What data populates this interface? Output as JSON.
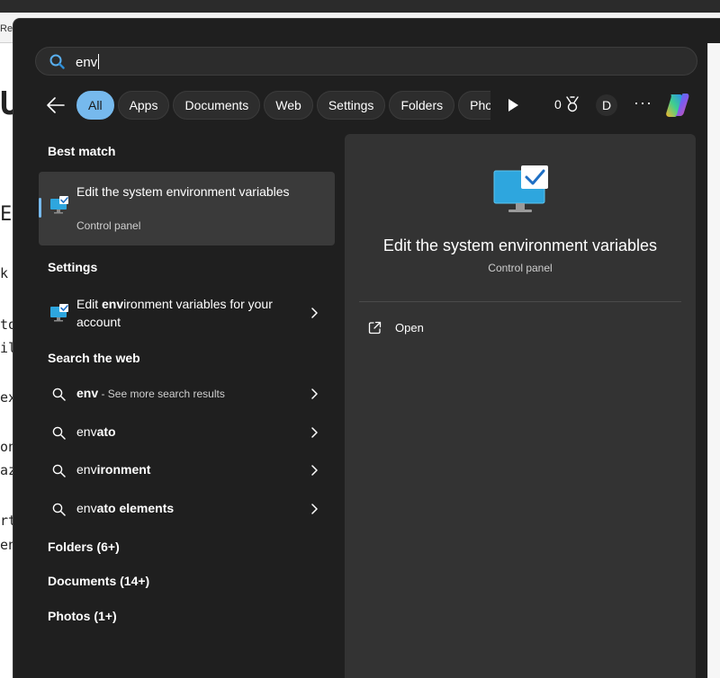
{
  "background": {
    "tab_text": "Rep",
    "fragments": [
      "U",
      "E",
      "k",
      "to",
      "il",
      "ext",
      "on",
      "az",
      "rt",
      "en"
    ]
  },
  "search": {
    "value": "env",
    "icon": "search-icon"
  },
  "filters": {
    "chips": [
      "All",
      "Apps",
      "Documents",
      "Web",
      "Settings",
      "Folders",
      "Photos"
    ],
    "active": "All",
    "points": "0",
    "avatar_initial": "D",
    "more": "···"
  },
  "results": {
    "best_match_heading": "Best match",
    "best_match": {
      "title": "Edit the system environment variables",
      "subtitle": "Control panel",
      "icon": "monitor-check-icon"
    },
    "settings_heading": "Settings",
    "settings_items": [
      {
        "pre": "Edit ",
        "bold": "env",
        "post": "ironment variables for your account",
        "icon": "monitor-check-icon"
      }
    ],
    "web_heading": "Search the web",
    "web_items": [
      {
        "bold": "env",
        "rest": "",
        "hint": " - See more search results"
      },
      {
        "bold": "env",
        "rest": "ato",
        "hint": ""
      },
      {
        "bold": "env",
        "rest": "ironment",
        "hint": ""
      },
      {
        "bold": "env",
        "rest": "ato elements",
        "hint": ""
      }
    ],
    "folders_heading": "Folders (6+)",
    "documents_heading": "Documents (14+)",
    "photos_heading": "Photos (1+)"
  },
  "preview": {
    "title": "Edit the system environment variables",
    "subtitle": "Control panel",
    "open_label": "Open",
    "icon": "monitor-check-icon"
  },
  "colors": {
    "accent": "#76b9ed",
    "flyout_bg": "#1f1f1f",
    "pane_bg": "#333333",
    "selected_bg": "#3a3a3a"
  }
}
